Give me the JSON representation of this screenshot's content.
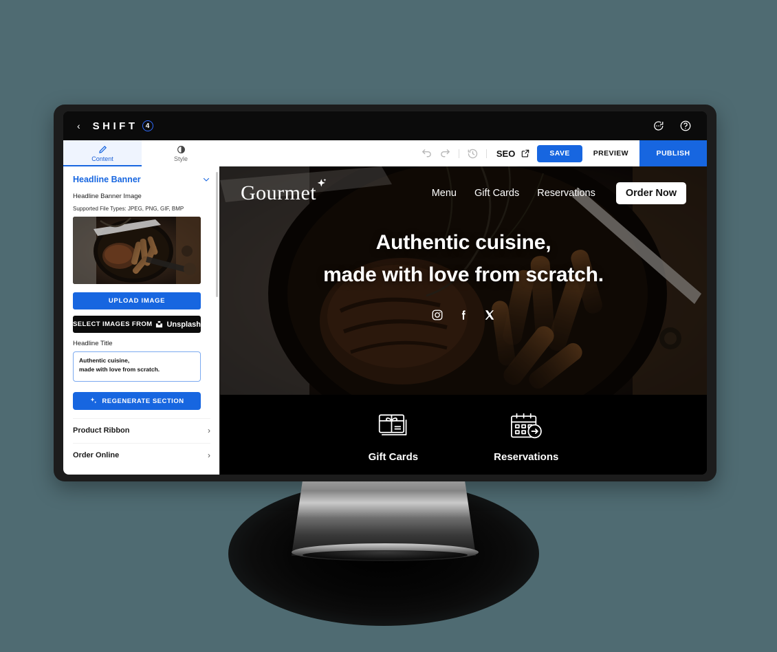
{
  "app": {
    "brand_name": "SHIFT",
    "brand_badge": "4",
    "back_icon": "chevron-left-icon",
    "chat_icon": "chat-bubble-icon",
    "help_icon": "help-circle-icon"
  },
  "toolbar": {
    "tabs": [
      {
        "label": "Content",
        "icon": "pencil-icon",
        "active": true
      },
      {
        "label": "Style",
        "icon": "contrast-icon",
        "active": false
      }
    ],
    "undo_icon": "undo-icon",
    "redo_icon": "redo-icon",
    "history_icon": "history-clock-icon",
    "seo_label": "SEO",
    "external_link_icon": "external-link-icon",
    "save_label": "SAVE",
    "preview_label": "PREVIEW",
    "publish_label": "PUBLISH",
    "accent_color": "#1766e0"
  },
  "sidebar": {
    "section_title": "Headline Banner",
    "collapse_icon": "chevron-down-icon",
    "image_label": "Headline Banner Image",
    "supported_types": "Supported File Types: JPEG, PNG, GIF, BMP",
    "thumbnail_alt": "steak-and-fries-skillet-thumbnail",
    "upload_label": "UPLOAD IMAGE",
    "unsplash_prefix": "SELECT IMAGES FROM",
    "unsplash_brand": "Unsplash",
    "unsplash_icon": "unsplash-icon",
    "headline_title_label": "Headline Title",
    "headline_title_value": "Authentic cuisine,\nmade with love from scratch.",
    "headline_title_placeholder": "Enter headline title",
    "regenerate_icon": "sparkle-icon",
    "regenerate_label": "REGENERATE SECTION",
    "rows": [
      {
        "label": "Product Ribbon",
        "chevron": "chevron-right-icon"
      },
      {
        "label": "Order Online",
        "chevron": "chevron-right-icon"
      }
    ]
  },
  "site": {
    "logo": "Gourmet",
    "logo_sparkle_icon": "sparkle-icon",
    "nav_links": [
      "Menu",
      "Gift Cards",
      "Reservations"
    ],
    "cta_label": "Order Now",
    "headline_line1": "Authentic cuisine,",
    "headline_line2": "made with love from scratch.",
    "socials": [
      {
        "name": "instagram-icon"
      },
      {
        "name": "facebook-icon"
      },
      {
        "name": "x-twitter-icon"
      }
    ],
    "tiles": [
      {
        "label": "Gift Cards",
        "icon": "gift-card-icon"
      },
      {
        "label": "Reservations",
        "icon": "calendar-arrow-icon"
      }
    ],
    "background_color": "#000000"
  },
  "page": {
    "background_color": "#4f6b72",
    "monitor_color": "#1c1c1c"
  }
}
